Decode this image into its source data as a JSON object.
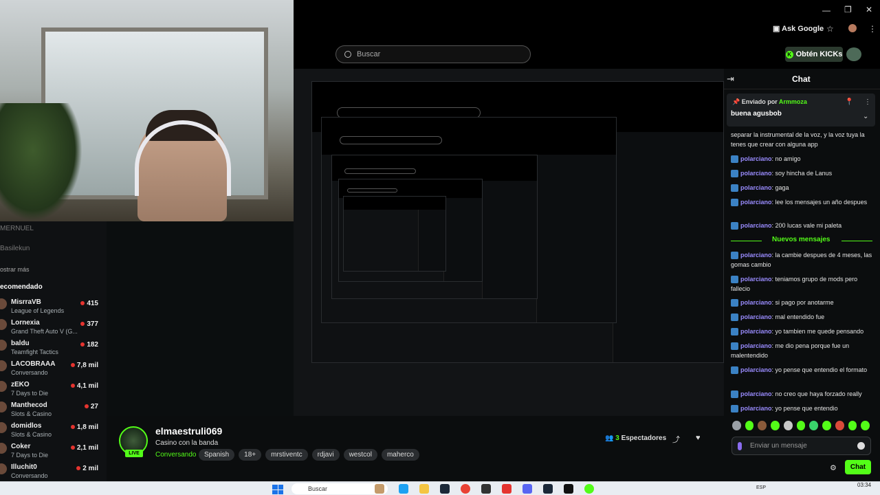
{
  "browser": {
    "ask_google": "Ask Google",
    "search_placeholder": "Buscar",
    "kicks_button": "Obtén KICKs"
  },
  "sidebar": {
    "followed": [
      "MERNUEL",
      "Basilekun"
    ],
    "show_more": "ostrar más",
    "recommended_title": "ecomendado",
    "items": [
      {
        "name": "MisrraVB",
        "category": "League of Legends",
        "viewers": "415"
      },
      {
        "name": "Lornexia",
        "category": "Grand Theft Auto V (G...",
        "viewers": "377"
      },
      {
        "name": "baldu",
        "category": "Teamfight Tactics",
        "viewers": "182"
      },
      {
        "name": "LACOBRAAA",
        "category": "Conversando",
        "viewers": "7,8 mil"
      },
      {
        "name": "zEKO",
        "category": "7 Days to Die",
        "viewers": "4,1 mil"
      },
      {
        "name": "Manthecod",
        "category": "Slots & Casino",
        "viewers": "27"
      },
      {
        "name": "domidlos",
        "category": "Slots & Casino",
        "viewers": "1,8 mil"
      },
      {
        "name": "Coker",
        "category": "7 Days to Die",
        "viewers": "2,1 mil"
      },
      {
        "name": "Illuchit0",
        "category": "Conversando",
        "viewers": "2 mil"
      }
    ]
  },
  "channel": {
    "name": "elmaestruli069",
    "title": "Casino con la banda",
    "category": "Conversando",
    "live": "LIVE",
    "tags": [
      "Spanish",
      "18+",
      "mrstiventc",
      "rdjavi",
      "westcol",
      "maherco"
    ],
    "viewers_count": "3",
    "viewers_label": "Espectadores"
  },
  "chat": {
    "title": "Chat",
    "pinned_by_label": "Enviado por",
    "pinned_by_user": "Armmoza",
    "pinned_message": "buena agusbob",
    "partial_message": "separar la instrumental de la voz, y la voz tuya la tenes que crear con alguna app",
    "messages_before": [
      {
        "user": "polarciano",
        "text": "no amigo"
      },
      {
        "user": "polarciano",
        "text": "soy hincha de Lanus"
      },
      {
        "user": "polarciano",
        "text": "gaga"
      },
      {
        "user": "polarciano",
        "text": "lee los mensajes un año despues"
      },
      {
        "user": "polarciano",
        "text": "200 lucas vale mi paleta"
      }
    ],
    "new_messages_label": "Nuevos mensajes",
    "messages_after": [
      {
        "user": "polarciano",
        "text": "la cambie despues de 4 meses, las gomas cambio"
      },
      {
        "user": "polarciano",
        "text": "teniamos grupo de mods pero fallecio"
      },
      {
        "user": "polarciano",
        "text": "si pago por anotarme"
      },
      {
        "user": "polarciano",
        "text": "mal entendido fue"
      },
      {
        "user": "polarciano",
        "text": "yo tambien me quede pensando"
      },
      {
        "user": "polarciano",
        "text": "me dio pena porque fue un malentendido"
      },
      {
        "user": "polarciano",
        "text": "yo pense que entendio el formato"
      },
      {
        "user": "polarciano",
        "text": "no creo que haya forzado really"
      },
      {
        "user": "polarciano",
        "text": "yo pense que entendio"
      }
    ],
    "input_placeholder": "Enviar un mensaje",
    "send_label": "Chat"
  },
  "taskbar": {
    "search_label": "Buscar",
    "lang": "ESP",
    "time": "03:34"
  },
  "colors": {
    "accent": "#53fc18",
    "username": "#9a8cff",
    "background": "#0b0d0e"
  }
}
